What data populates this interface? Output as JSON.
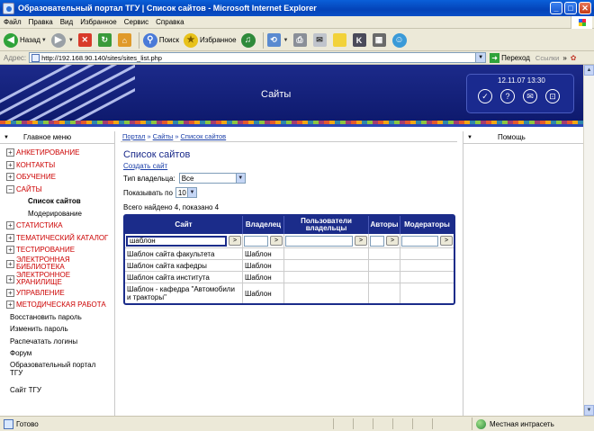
{
  "window": {
    "title": "Образовательный портал ТГУ | Список сайтов - Microsoft Internet Explorer",
    "controls": {
      "minimize": "_",
      "maximize": "□",
      "close": "✕"
    }
  },
  "menubar": [
    "Файл",
    "Правка",
    "Вид",
    "Избранное",
    "Сервис",
    "Справка"
  ],
  "toolbar": {
    "back": "Назад",
    "search": "Поиск",
    "favorites": "Избранное"
  },
  "addressbar": {
    "label": "Адрес:",
    "url": "http://192.168.90.140/sites/sites_list.php",
    "go": "Переход",
    "links": "Ссылки",
    "more": "»"
  },
  "banner": {
    "title": "Сайты",
    "datetime": "12.11.07 13:30",
    "icons": [
      "check-icon",
      "help-icon",
      "mail-icon",
      "lock-icon"
    ]
  },
  "sidebar": {
    "header": "Главное меню",
    "items": [
      {
        "label": "АНКЕТИРОВАНИЕ",
        "state": "+"
      },
      {
        "label": "КОНТАКТЫ",
        "state": "+"
      },
      {
        "label": "ОБУЧЕНИЕ",
        "state": "+"
      },
      {
        "label": "САЙТЫ",
        "state": "−"
      }
    ],
    "subitems": [
      "Список сайтов",
      "Модерирование"
    ],
    "items2": [
      {
        "label": "СТАТИСТИКА",
        "state": "+"
      },
      {
        "label": "ТЕМАТИЧЕСКИЙ КАТАЛОГ",
        "state": "+"
      },
      {
        "label": "ТЕСТИРОВАНИЕ",
        "state": "+"
      },
      {
        "label": "ЭЛЕКТРОННАЯ БИБЛИОТЕКА",
        "state": "+"
      },
      {
        "label": "ЭЛЕКТРОННОЕ ХРАНИЛИЩЕ",
        "state": "+"
      },
      {
        "label": "УПРАВЛЕНИЕ",
        "state": "+"
      },
      {
        "label": "МЕТОДИЧЕСКАЯ РАБОТА",
        "state": "+"
      }
    ],
    "links": [
      "Восстановить пароль",
      "Изменить пароль",
      "Распечатать логины",
      "Форум",
      "Образовательный портал ТГУ",
      "Сайт ТГУ"
    ]
  },
  "rightbar": {
    "header": "Помощь"
  },
  "breadcrumb": [
    "Портал",
    "Сайты",
    "Список сайтов"
  ],
  "breadcrumb_sep": "»",
  "main": {
    "title": "Список сайтов",
    "create_link": "Создать сайт",
    "owner_type_label": "Тип владельца:",
    "owner_type_value": "Все",
    "per_page_label": "Показывать по",
    "per_page_value": "10",
    "found_text": "Всего найдено 4, показано 4"
  },
  "table": {
    "headers": [
      "Сайт",
      "Владелец",
      "Пользователи владельцы",
      "Авторы",
      "Модераторы"
    ],
    "filter_value": "шаблон",
    "filter_button": ">",
    "rows": [
      [
        "Шаблон сайта факультета",
        "Шаблон",
        "",
        "",
        ""
      ],
      [
        "Шаблон сайта кафедры",
        "Шаблон",
        "",
        "",
        ""
      ],
      [
        "Шаблон сайта института",
        "Шаблон",
        "",
        "",
        ""
      ],
      [
        "Шаблон - кафедра \"Автомобили и тракторы\"",
        "Шаблон",
        "",
        "",
        ""
      ]
    ]
  },
  "statusbar": {
    "status": "Готово",
    "zone": "Местная интрасеть"
  },
  "colors": {
    "title_bar": "#0443b8",
    "banner": "#1c2a8a",
    "table_header": "#1b2c8a",
    "menu_red": "#cc0000",
    "link_blue": "#1a3ea8"
  }
}
